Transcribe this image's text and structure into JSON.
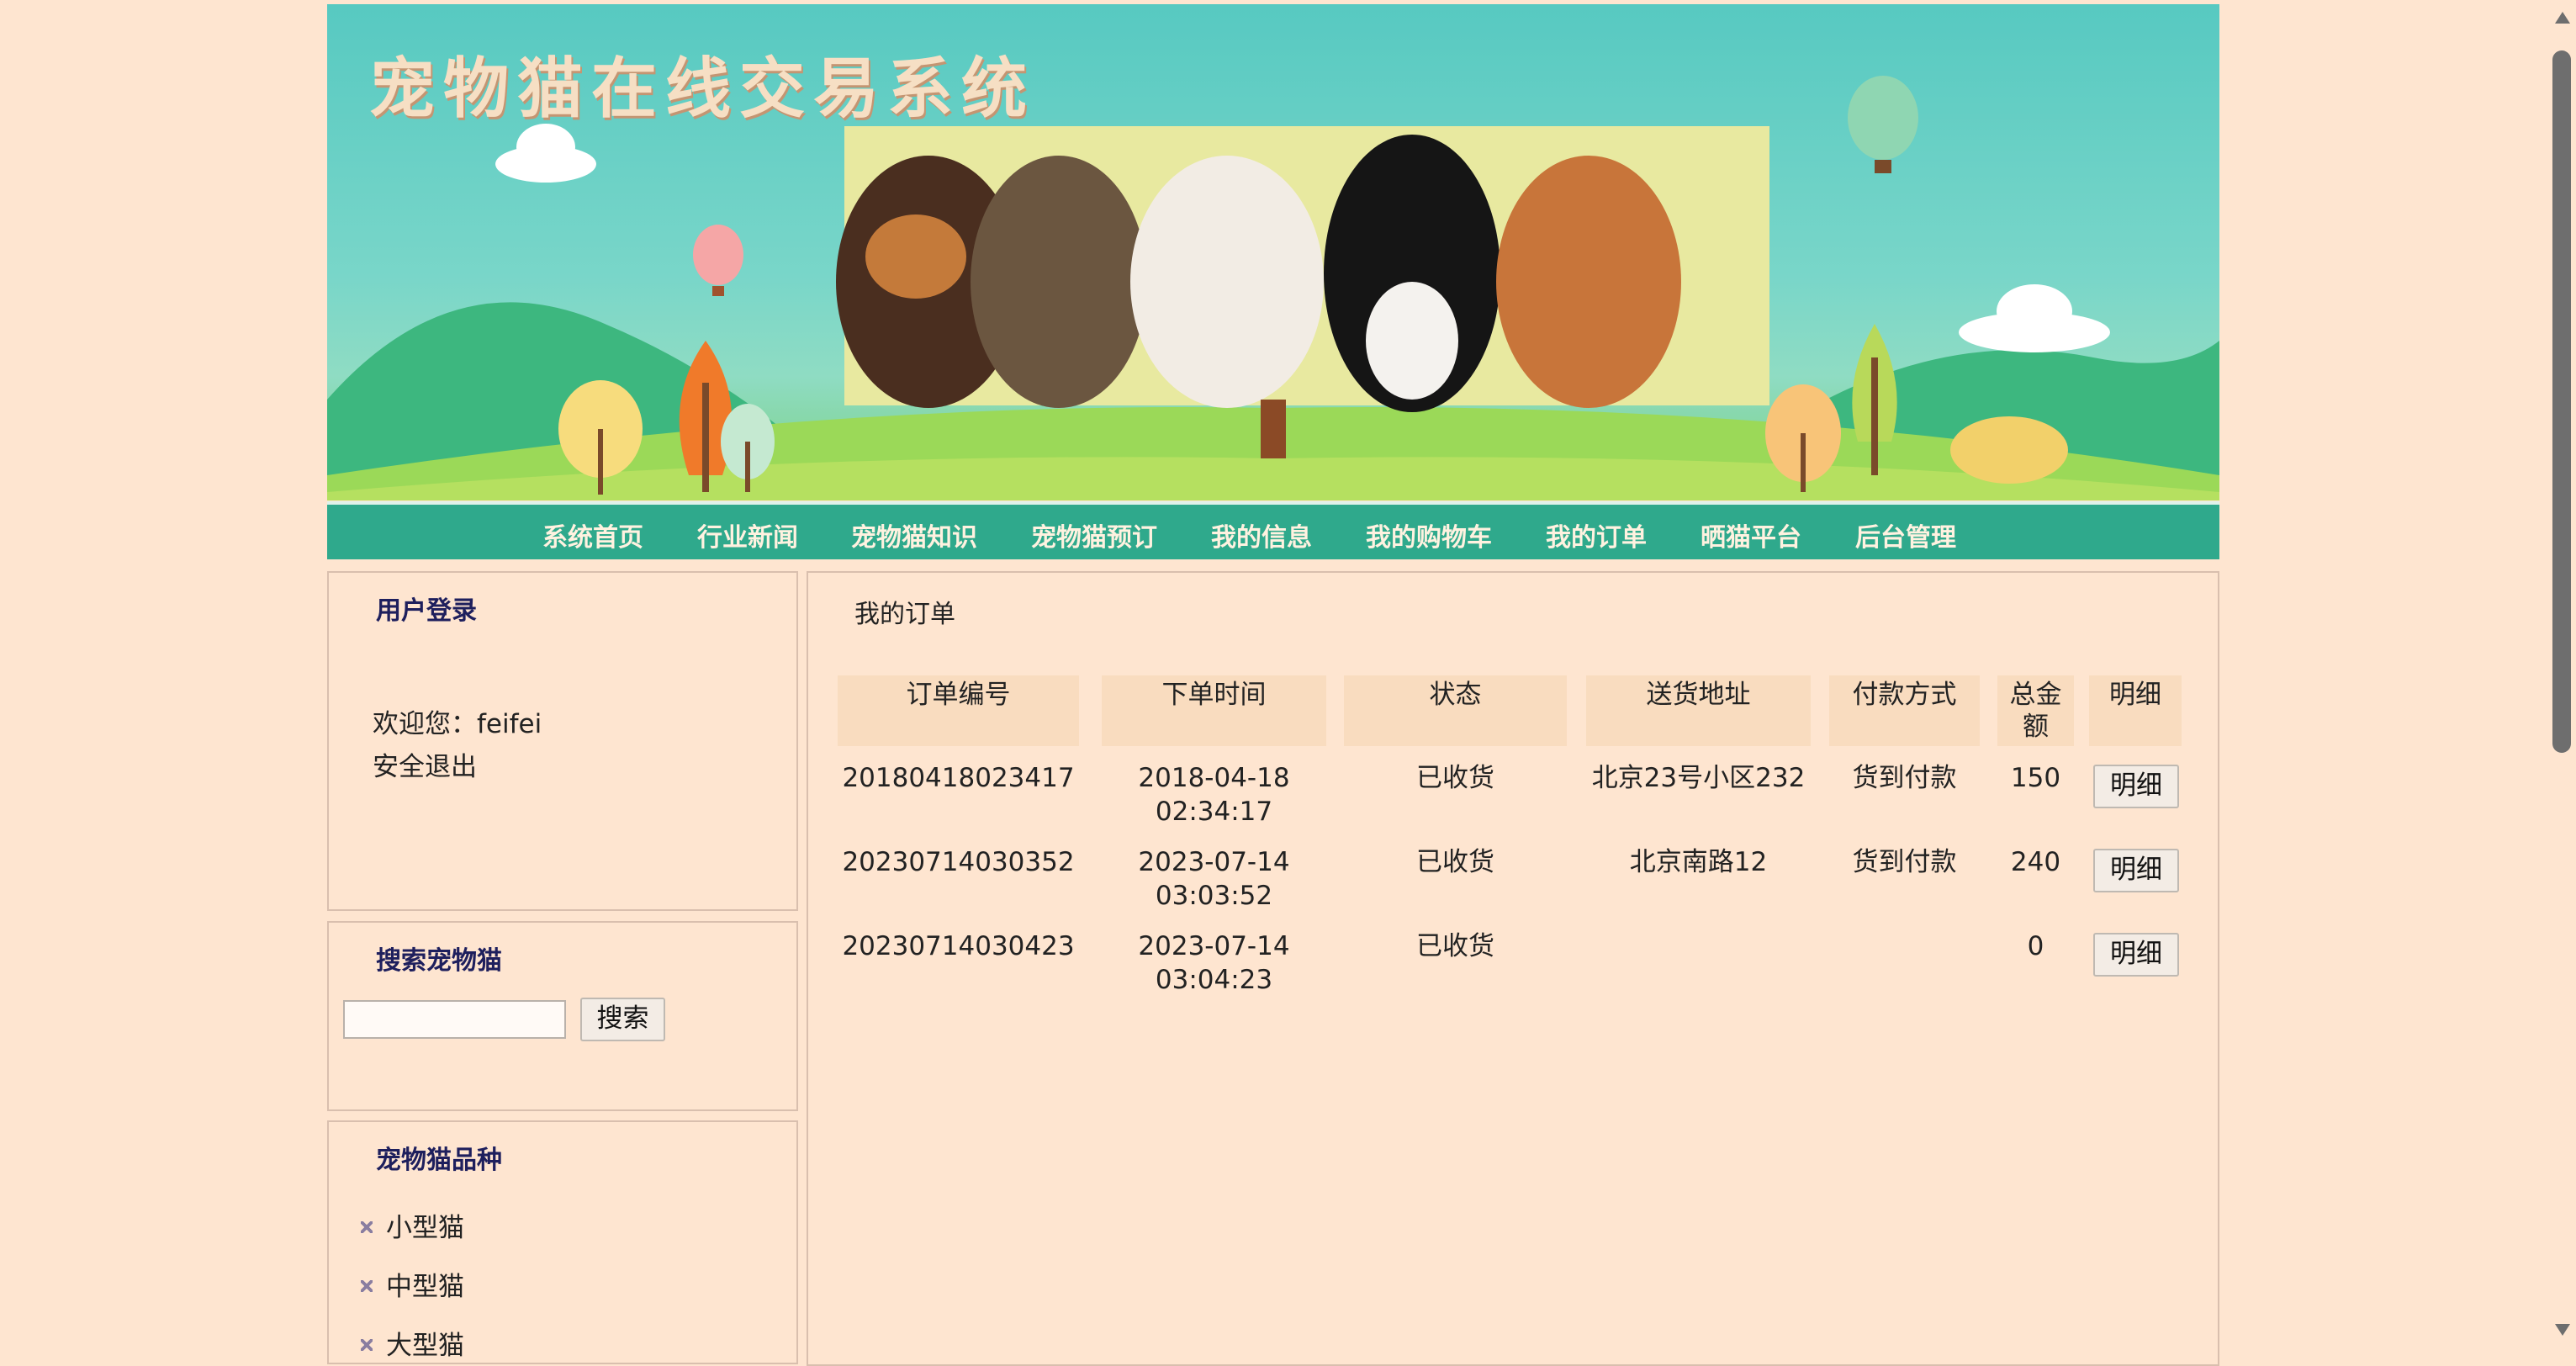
{
  "banner": {
    "title": "宠物猫在线交易系统"
  },
  "nav": {
    "items": [
      "系统首页",
      "行业新闻",
      "宠物猫知识",
      "宠物猫预订",
      "我的信息",
      "我的购物车",
      "我的订单",
      "晒猫平台",
      "后台管理"
    ]
  },
  "login": {
    "title": "用户登录",
    "welcome": "欢迎您：feifei",
    "logout": "安全退出"
  },
  "search": {
    "title": "搜索宠物猫",
    "placeholder": "",
    "button": "搜索"
  },
  "breeds": {
    "title": "宠物猫品种",
    "items": [
      "小型猫",
      "中型猫",
      "大型猫"
    ]
  },
  "orders": {
    "title": "我的订单",
    "headers": [
      "订单编号",
      "下单时间",
      "状态",
      "送货地址",
      "付款方式",
      "总金\n额",
      "明细"
    ],
    "rows": [
      {
        "id": "20180418023417",
        "date": "2018-04-18",
        "time": "02:34:17",
        "status": "已收货",
        "address": "北京23号小区232",
        "payment": "货到付款",
        "total": "150",
        "detail": "明细"
      },
      {
        "id": "20230714030352",
        "date": "2023-07-14",
        "time": "03:03:52",
        "status": "已收货",
        "address": "北京南路12",
        "payment": "货到付款",
        "total": "240",
        "detail": "明细"
      },
      {
        "id": "20230714030423",
        "date": "2023-07-14",
        "time": "03:04:23",
        "status": "已收货",
        "address": "",
        "payment": "",
        "total": "0",
        "detail": "明细"
      }
    ]
  },
  "colors": {
    "page_bg": "#fee5d0",
    "nav_bg": "#2fa98c",
    "header_cell": "#f9dcbf",
    "panel_title": "#1e1f5d"
  }
}
